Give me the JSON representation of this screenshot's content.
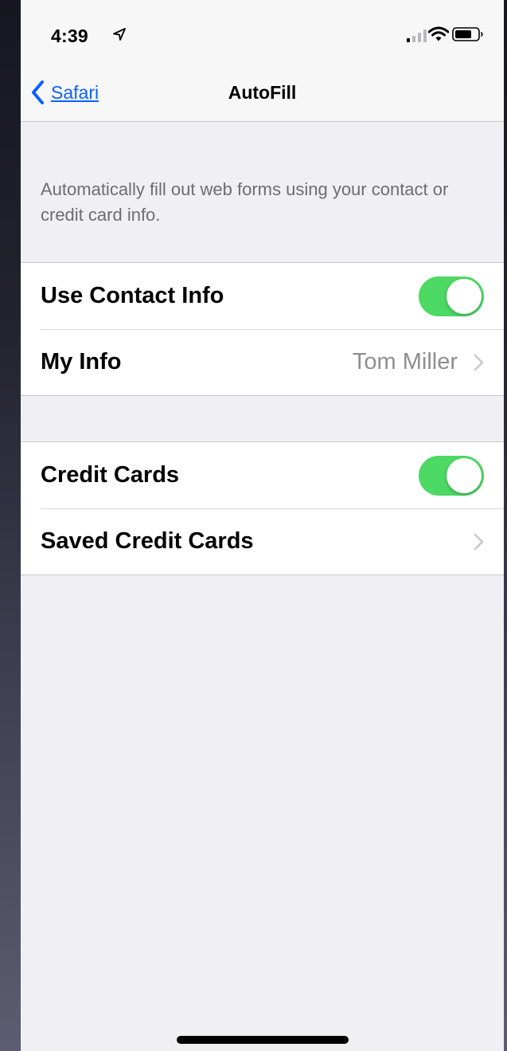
{
  "status_bar": {
    "time": "4:39",
    "icons": [
      "location-arrow-icon",
      "cellular-signal-icon",
      "wifi-icon",
      "battery-icon"
    ]
  },
  "nav": {
    "back_label": "Safari",
    "title": "AutoFill"
  },
  "description": "Automatically fill out web forms using your contact or credit card info.",
  "groups": [
    {
      "rows": [
        {
          "label": "Use Contact Info",
          "toggle_on": true
        },
        {
          "label": "My Info",
          "value": "Tom Miller"
        }
      ]
    },
    {
      "rows": [
        {
          "label": "Credit Cards",
          "toggle_on": true
        },
        {
          "label": "Saved Credit Cards"
        }
      ]
    }
  ],
  "colors": {
    "accent": "#0a60ff",
    "toggle_on": "#4cd964",
    "background": "#efeff4",
    "secondary_text": "#8e8e93"
  }
}
